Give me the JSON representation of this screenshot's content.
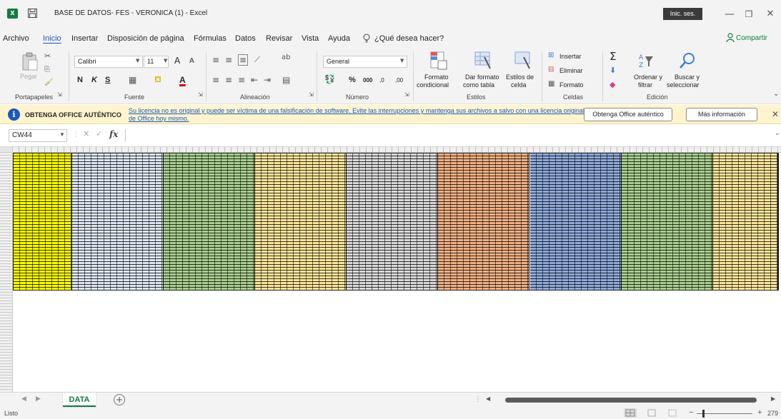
{
  "window": {
    "title": "BASE DE DATOS- FES - VERONICA (1)  -  Excel",
    "app_badge": "X",
    "signin_label": "Inic. ses.",
    "minimize": "—",
    "restore": "❐",
    "close": "✕"
  },
  "menu": {
    "tabs": [
      "Archivo",
      "Inicio",
      "Insertar",
      "Disposición de página",
      "Fórmulas",
      "Datos",
      "Revisar",
      "Vista",
      "Ayuda"
    ],
    "active_tab": "Inicio",
    "tell_me": "¿Qué desea hacer?",
    "share": "Compartir"
  },
  "ribbon": {
    "clipboard": {
      "label": "Portapapeles",
      "paste": "Pegar"
    },
    "font": {
      "label": "Fuente",
      "font_name": "Calibri",
      "font_size": "11",
      "bold": "N",
      "italic": "K",
      "underline": "S",
      "grow": "A",
      "shrink": "A"
    },
    "alignment": {
      "label": "Alineación"
    },
    "number": {
      "label": "Número",
      "format": "General",
      "percent": "%",
      "thousands": "000",
      "inc_dec": ",0",
      "dec_dec": ",00"
    },
    "styles": {
      "label": "Estilos",
      "conditional_line1": "Formato",
      "conditional_line2": "condicional",
      "table_line1": "Dar formato",
      "table_line2": "como tabla",
      "cell_line1": "Estilos de",
      "cell_line2": "celda"
    },
    "cells": {
      "label": "Celdas",
      "insert": "Insertar",
      "delete": "Eliminar",
      "format": "Formato"
    },
    "editing": {
      "label": "Edición",
      "sort_line1": "Ordenar y",
      "sort_line2": "filtrar",
      "find_line1": "Buscar y",
      "find_line2": "seleccionar"
    }
  },
  "license_bar": {
    "heading": "OBTENGA OFFICE AUTÉNTICO",
    "message": "Su licencia no es original y puede ser víctima de una falsificación de software. Evite las interrupciones y mantenga sus archivos a salvo con una licencia original de Office hoy mismo.",
    "btn_genuine": "Obtenga Office auténtico",
    "btn_more": "Más información",
    "close": "✕"
  },
  "formula_bar": {
    "name_box": "CW44",
    "cancel": "✕",
    "enter": "✓",
    "fx": "fx",
    "value": ""
  },
  "grid": {
    "bands": [
      {
        "color": "#ffff00",
        "cols": 9
      },
      {
        "color": "#dde7f4",
        "cols": 14
      },
      {
        "color": "#a9d08e",
        "cols": 14
      },
      {
        "color": "#ffe699",
        "cols": 14
      },
      {
        "color": "#d9d9d9",
        "cols": 14
      },
      {
        "color": "#f4b183",
        "cols": 14
      },
      {
        "color": "#8eaadb",
        "cols": 14
      },
      {
        "color": "#a9d08e",
        "cols": 14
      },
      {
        "color": "#ffe699",
        "cols": 10
      }
    ]
  },
  "sheets": {
    "tabs": [
      "DATA"
    ],
    "active": "DATA",
    "add": "+"
  },
  "status": {
    "text": "Listo",
    "zoom": "279",
    "zoom_minus": "−",
    "zoom_plus": "+"
  },
  "colors": {
    "accent": "#185abd",
    "excel_green": "#107c41",
    "license_bg": "#fff4ce"
  }
}
